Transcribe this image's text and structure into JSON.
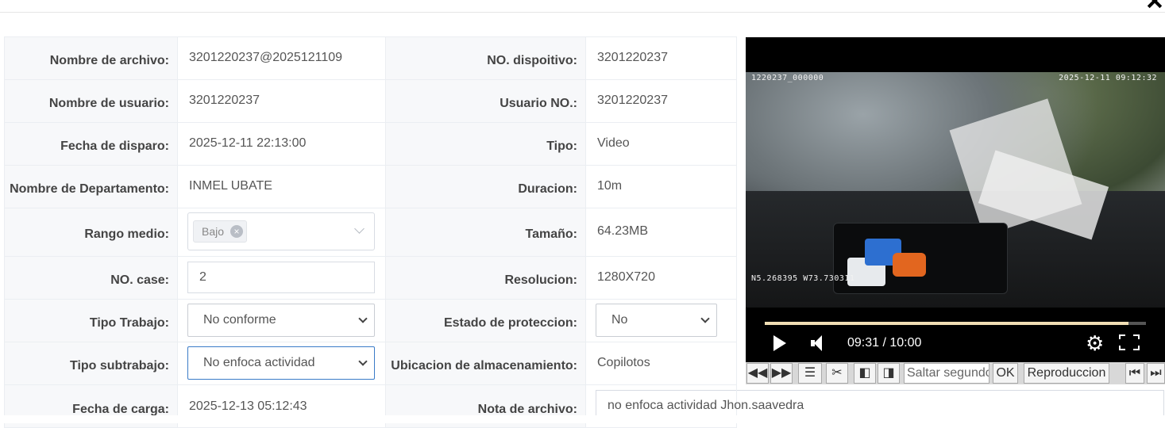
{
  "fields": {
    "file_name": {
      "label": "Nombre de archivo:",
      "value": "3201220237@2025121109"
    },
    "device_no": {
      "label": "NO. dispoitivo:",
      "value": "3201220237"
    },
    "user_name": {
      "label": "Nombre de usuario:",
      "value": "3201220237"
    },
    "user_no": {
      "label": "Usuario NO.:",
      "value": "3201220237"
    },
    "trigger_date": {
      "label": "Fecha de disparo:",
      "value": "2025-12-11 22:13:00"
    },
    "type": {
      "label": "Tipo:",
      "value": "Video"
    },
    "department": {
      "label": "Nombre de Departamento:",
      "value": "INMEL UBATE"
    },
    "duration": {
      "label": "Duracion:",
      "value": "10m"
    },
    "range": {
      "label": "Rango medio:",
      "tag": "Bajo"
    },
    "size": {
      "label": "Tamaño:",
      "value": "64.23MB"
    },
    "case_no": {
      "label": "NO. case:",
      "value": "2"
    },
    "resolution": {
      "label": "Resolucion:",
      "value": "1280X720"
    },
    "work_type": {
      "label": "Tipo Trabajo:",
      "value": "No conforme"
    },
    "protection_state": {
      "label": "Estado de proteccion:",
      "value": "No"
    },
    "work_subtype": {
      "label": "Tipo subtrabajo:",
      "value": "No enfoca actividad"
    },
    "storage_location": {
      "label": "Ubicacion de almacenamiento:",
      "value": "Copilotos"
    },
    "upload_date": {
      "label": "Fecha de carga:",
      "value": "2025-12-13 05:12:43"
    },
    "file_note": {
      "label": "Nota de archivo:",
      "value": "no enfoca actividad Jhon.saavedra"
    }
  },
  "player": {
    "osd_top_left": "1220237_000000",
    "osd_top_right": "2025-12-11  09:12:32",
    "osd_gps": "N5.268395  W73.730311",
    "time": "09:31 / 10:00",
    "progress": 0.955
  },
  "toolbar": {
    "seek_placeholder": "Saltar segundo",
    "ok_label": "OK",
    "playback_label": "Reproduccion"
  },
  "icons": {
    "close": "close-icon",
    "play": "play-icon",
    "volume": "volume-icon",
    "settings": "gear-icon",
    "fullscreen": "fullscreen-icon"
  }
}
